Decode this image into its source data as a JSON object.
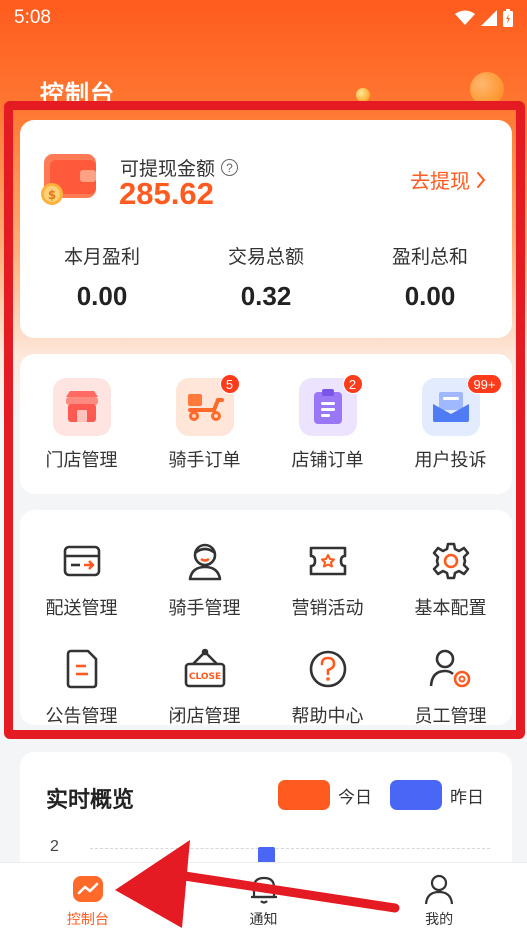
{
  "status_bar": {
    "time": "5:08"
  },
  "header": {
    "title": "控制台"
  },
  "balance": {
    "label": "可提现金额",
    "amount": "285.62",
    "withdraw_label": "去提现",
    "stats": [
      {
        "label": "本月盈利",
        "value": "0.00"
      },
      {
        "label": "交易总额",
        "value": "0.32"
      },
      {
        "label": "盈利总和",
        "value": "0.00"
      }
    ]
  },
  "quick_menu": [
    {
      "label": "门店管理",
      "icon": "store-icon",
      "badge": ""
    },
    {
      "label": "骑手订单",
      "icon": "scooter-icon",
      "badge": "5"
    },
    {
      "label": "店铺订单",
      "icon": "clipboard-icon",
      "badge": "2"
    },
    {
      "label": "用户投诉",
      "icon": "mail-icon",
      "badge": "99+"
    }
  ],
  "tools_menu": [
    {
      "label": "配送管理",
      "icon": "delivery-box-icon"
    },
    {
      "label": "骑手管理",
      "icon": "rider-icon"
    },
    {
      "label": "营销活动",
      "icon": "coupon-icon"
    },
    {
      "label": "基本配置",
      "icon": "gear-icon"
    },
    {
      "label": "公告管理",
      "icon": "notice-doc-icon"
    },
    {
      "label": "闭店管理",
      "icon": "closed-sign-icon"
    },
    {
      "label": "帮助中心",
      "icon": "help-icon"
    },
    {
      "label": "员工管理",
      "icon": "staff-settings-icon"
    }
  ],
  "overview": {
    "title": "实时概览",
    "legend": [
      {
        "label": "今日",
        "color": "#ff5a1f"
      },
      {
        "label": "昨日",
        "color": "#4a66f5"
      }
    ],
    "axis_tick": "2"
  },
  "tabs": [
    {
      "label": "控制台",
      "icon": "dashboard-icon",
      "active": true
    },
    {
      "label": "通知",
      "icon": "bell-icon",
      "active": false
    },
    {
      "label": "我的",
      "icon": "user-icon",
      "active": false
    }
  ],
  "colors": {
    "accent": "#ff5a1f",
    "highlight": "#e41b22",
    "series_yesterday": "#4a66f5"
  }
}
